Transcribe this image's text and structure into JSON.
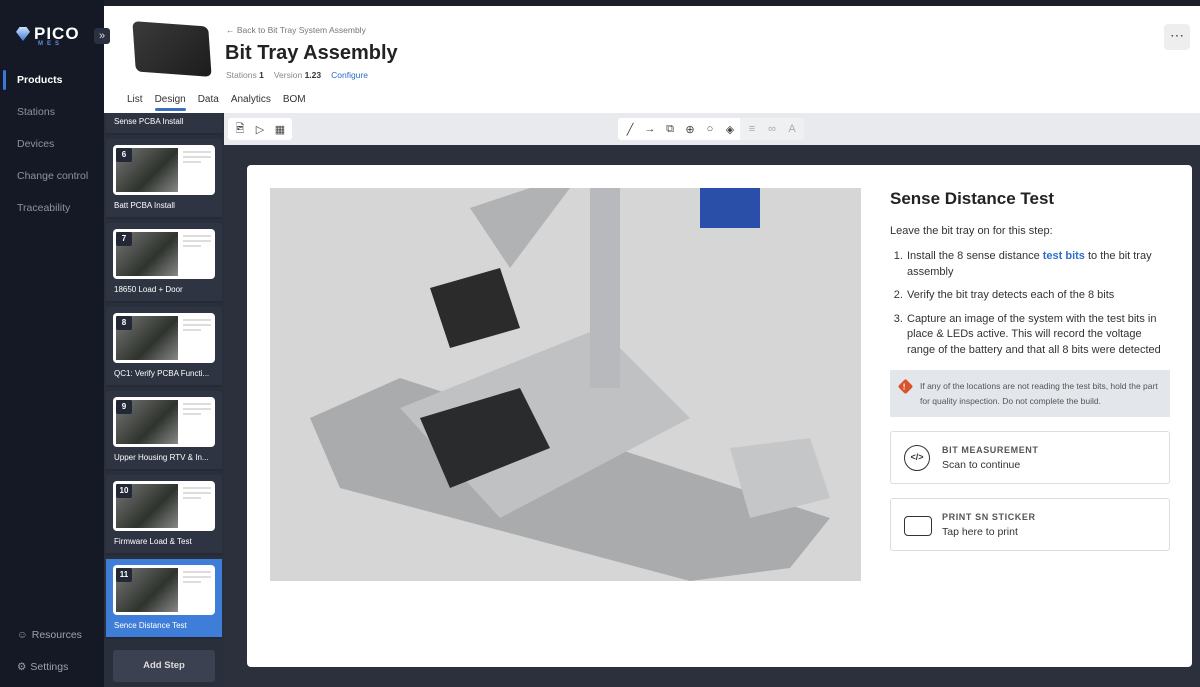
{
  "brand": {
    "name": "PICO",
    "sub": "MES",
    "accent": "#3a7bd5"
  },
  "sidebar": {
    "items": [
      {
        "label": "Products",
        "active": true
      },
      {
        "label": "Stations"
      },
      {
        "label": "Devices"
      },
      {
        "label": "Change control"
      },
      {
        "label": "Traceability"
      }
    ],
    "footer": [
      {
        "label": "Resources",
        "icon": "help-chat-icon"
      },
      {
        "label": "Settings",
        "icon": "gear-icon"
      }
    ]
  },
  "header": {
    "back": "← Back to Bit Tray System Assembly",
    "title": "Bit Tray Assembly",
    "stations_label": "Stations",
    "stations": "1",
    "version_label": "Version",
    "version": "1.23",
    "configure": "Configure",
    "more": "⋯",
    "tabs": [
      {
        "label": "List"
      },
      {
        "label": "Design",
        "active": true
      },
      {
        "label": "Data"
      },
      {
        "label": "Analytics"
      },
      {
        "label": "BOM"
      }
    ]
  },
  "steps": [
    {
      "num": "",
      "label": "Sense PCBA Install"
    },
    {
      "num": "6",
      "label": "Batt PCBA Install"
    },
    {
      "num": "7",
      "label": "18650 Load + Door"
    },
    {
      "num": "8",
      "label": "QC1: Verify PCBA Functi..."
    },
    {
      "num": "9",
      "label": "Upper Housing RTV & In..."
    },
    {
      "num": "10",
      "label": "Firmware Load & Test"
    },
    {
      "num": "11",
      "label": "Sence Distance Test",
      "selected": true
    }
  ],
  "add_step": "Add Step",
  "toolbar": {
    "left": [
      "image-icon",
      "video-icon",
      "table-icon"
    ],
    "draw": [
      "line-icon",
      "arrow-icon",
      "shape-icon",
      "target-icon",
      "marker-icon",
      "number-marker-icon"
    ],
    "format": [
      "align-icon",
      "link-icon",
      "text-color-icon"
    ]
  },
  "content": {
    "title": "Sense Distance Test",
    "intro": "Leave the bit tray on for this step:",
    "steps": [
      {
        "pre": "Install the 8 sense distance ",
        "link": "test bits",
        "post": " to the bit tray assembly"
      },
      {
        "pre": "Verify the bit tray detects each of the 8 bits"
      },
      {
        "pre": "Capture an image of the system with the test bits in place & LEDs active. This will record the voltage range of the battery and that all 8 bits were detected"
      }
    ],
    "warning": "If any of the locations are not reading the test bits, hold the part for quality inspection. Do not complete the build.",
    "actions": [
      {
        "title": "BIT MEASUREMENT",
        "subtitle": "Scan to continue",
        "icon": "code-icon"
      },
      {
        "title": "PRINT SN STICKER",
        "subtitle": "Tap here to print",
        "icon": "print-tap-icon"
      }
    ]
  }
}
